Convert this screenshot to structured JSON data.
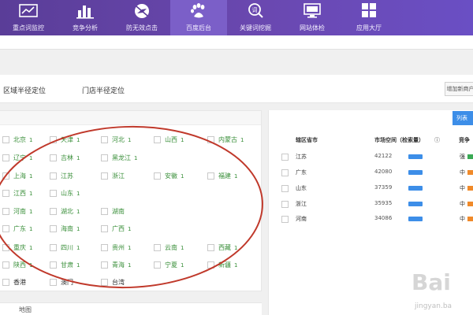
{
  "nav": {
    "items": [
      {
        "label": "重点词监控",
        "icon": "monitor-chart-icon"
      },
      {
        "label": "竞争分析",
        "icon": "bar-chart-icon"
      },
      {
        "label": "防无效点击",
        "icon": "no-plane-icon"
      },
      {
        "label": "百度后台",
        "icon": "baidu-paw-icon",
        "active": true
      },
      {
        "label": "关键词挖掘",
        "icon": "keyword-search-icon"
      },
      {
        "label": "网站体检",
        "icon": "monitor-icon"
      },
      {
        "label": "应用大厅",
        "icon": "grid-apps-icon"
      }
    ]
  },
  "tabs": {
    "region_label": "区域半径定位",
    "store_label": "门店半径定位",
    "right_button": "增加新商户"
  },
  "regions": [
    {
      "name": "北京",
      "count": "1"
    },
    {
      "name": "天津",
      "count": "1"
    },
    {
      "name": "河北",
      "count": "1"
    },
    {
      "name": "山西",
      "count": "1"
    },
    {
      "name": "内蒙古",
      "count": "1"
    },
    {
      "name": "辽宁",
      "count": "1"
    },
    {
      "name": "吉林",
      "count": "1"
    },
    {
      "name": "黑龙江",
      "count": "1"
    },
    {
      "name": "上海",
      "count": "1"
    },
    {
      "name": "江苏",
      "count": ""
    },
    {
      "name": "浙江",
      "count": ""
    },
    {
      "name": "安徽",
      "count": "1"
    },
    {
      "name": "福建",
      "count": "1"
    },
    {
      "name": "江西",
      "count": "1"
    },
    {
      "name": "山东",
      "count": "1"
    },
    {
      "name": "河南",
      "count": "1"
    },
    {
      "name": "湖北",
      "count": "1"
    },
    {
      "name": "湖南",
      "count": ""
    },
    {
      "name": "广东",
      "count": "1"
    },
    {
      "name": "海南",
      "count": "1"
    },
    {
      "name": "广西",
      "count": "1"
    },
    {
      "name": "重庆",
      "count": "1"
    },
    {
      "name": "四川",
      "count": "1"
    },
    {
      "name": "贵州",
      "count": "1"
    },
    {
      "name": "云南",
      "count": "1"
    },
    {
      "name": "西藏",
      "count": "1"
    },
    {
      "name": "陕西",
      "count": "1"
    },
    {
      "name": "甘肃",
      "count": "1"
    },
    {
      "name": "青海",
      "count": "1"
    },
    {
      "name": "宁夏",
      "count": "1"
    },
    {
      "name": "新疆",
      "count": "1"
    },
    {
      "name": "香港",
      "count": ""
    },
    {
      "name": "澳门",
      "count": ""
    },
    {
      "name": "台湾",
      "count": ""
    }
  ],
  "left_bottom": "地图",
  "table": {
    "button": "列表",
    "headers": {
      "province": "辖区省市",
      "search": "市场空间（检索量）",
      "competition": "竞争"
    },
    "rows": [
      {
        "name": "江苏",
        "value": "42122",
        "level": "强",
        "chip_color": "#3aaa55"
      },
      {
        "name": "广东",
        "value": "42080",
        "level": "中",
        "chip_color": "#f08a2a"
      },
      {
        "name": "山东",
        "value": "37359",
        "level": "中",
        "chip_color": "#f08a2a"
      },
      {
        "name": "浙江",
        "value": "35935",
        "level": "中",
        "chip_color": "#f08a2a"
      },
      {
        "name": "河南",
        "value": "34086",
        "level": "中",
        "chip_color": "#f08a2a"
      }
    ]
  },
  "watermark": {
    "brand": "Bai",
    "sub": "jingyan.ba"
  },
  "colors": {
    "nav_bg": "#5a3d98",
    "accent_blue": "#3d8ee8",
    "region_green": "#3a8f3a",
    "annotation_red": "#c0392b"
  }
}
